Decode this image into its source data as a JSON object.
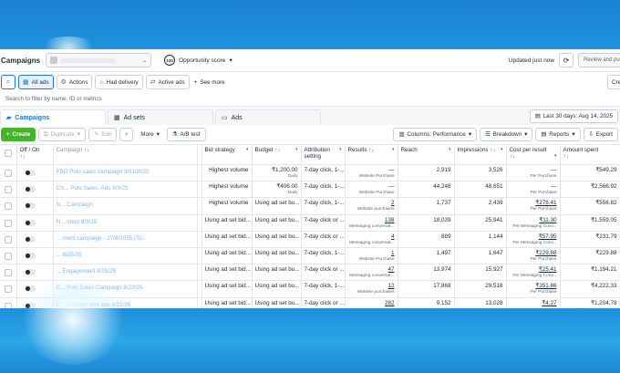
{
  "header": {
    "title": "Campaigns",
    "opportunity_score_badge": "100",
    "opportunity_label": "Opportunity score",
    "updated": "Updated just now",
    "review_label": "Review and pul"
  },
  "filters": {
    "all_ads": "All ads",
    "actions": "Actions",
    "had_delivery": "Had delivery",
    "active_ads": "Active ads",
    "see_more": "See more",
    "create_partial": "Cre",
    "search_placeholder": "Search to filter by name, ID or metrics"
  },
  "tabs": [
    {
      "label": "Campaigns"
    },
    {
      "label": "Ad sets"
    },
    {
      "label": "Ads"
    }
  ],
  "date_range": "Last 30 days: Aug 14, 2025",
  "toolbar": {
    "create": "Create",
    "duplicate": "Duplicate",
    "edit": "Edit",
    "more": "More",
    "ab_test": "A/B test",
    "columns": "Columns: Performance",
    "breakdown": "Breakdown",
    "reports": "Reports",
    "export": "Export"
  },
  "columns": {
    "off_on": "Off / On",
    "campaign": "Campaign",
    "bid_strategy": "Bid strategy",
    "budget": "Budget",
    "attribution_1": "Attribution",
    "attribution_2": "setting",
    "results": "Results",
    "reach": "Reach",
    "impressions": "Impressions",
    "cost_per_result": "Cost per result",
    "amount_spent": "Amount spent",
    "sort_glyph": "↑↓"
  },
  "rows": [
    {
      "campaign": "FSO Polo sales campaign 9/11/2025",
      "bid": "Highest volume",
      "budget": "₹1,200.00",
      "budget_sub": "Daily",
      "attribution": "7-day click, 1-...",
      "results": "—",
      "results_sub": "Website Purchase",
      "results_link": false,
      "reach": "2,919",
      "impressions": "3,526",
      "cost": "—",
      "cost_sub": "Per Purchase",
      "cost_link": false,
      "spent": "₹549.29"
    },
    {
      "campaign": "CS... Polo Sales. Ads 9/5/25",
      "bid": "Highest volume",
      "budget": "₹406.00",
      "budget_sub": "Daily",
      "attribution": "7-day click, 1-...",
      "results": "—",
      "results_sub": "Website Purchase",
      "results_link": false,
      "reach": "44,248",
      "impressions": "48,651",
      "cost": "—",
      "cost_sub": "Per Purchase",
      "cost_link": false,
      "spent": "₹2,566.92"
    },
    {
      "campaign": "N... Campaign",
      "bid": "Highest volume",
      "budget": "Using ad set bu...",
      "budget_sub": "",
      "attribution": "7-day click, 1-...",
      "results": "2",
      "results_sub": "Website purchases",
      "results_link": true,
      "reach": "1,737",
      "impressions": "2,439",
      "cost": "₹278.41",
      "cost_sub": "Per Purchase",
      "cost_link": true,
      "spent": "₹556.82"
    },
    {
      "campaign": "N... ment 8/3/25",
      "bid": "Using ad set bid...",
      "budget": "Using ad set bu...",
      "budget_sub": "",
      "attribution": "7-day click or ...",
      "results": "138",
      "results_sub": "Messaging conversat...",
      "results_link": true,
      "reach": "18,039",
      "impressions": "25,941",
      "cost": "₹11.30",
      "cost_sub": "Per Messaging Conv...",
      "cost_link": true,
      "spent": "₹1,559.05"
    },
    {
      "campaign": "... ment campaign - 27/8/2025 (To...",
      "bid": "Using ad set bid...",
      "budget": "Using ad set bu...",
      "budget_sub": "",
      "attribution": "7-day click or ...",
      "results": "4",
      "results_sub": "Messaging conversat...",
      "results_link": true,
      "reach": "889",
      "impressions": "1,144",
      "cost": "₹57.95",
      "cost_sub": "Per Messaging Conv...",
      "cost_link": true,
      "spent": "₹231.79"
    },
    {
      "campaign": "... 8/25/25",
      "bid": "Using ad set bid...",
      "budget": "Using ad set bu...",
      "budget_sub": "",
      "attribution": "7-day click, 1-...",
      "results": "1",
      "results_sub": "Website Purchase",
      "results_link": true,
      "reach": "1,497",
      "impressions": "1,647",
      "cost": "₹229.88",
      "cost_sub": "Per Purchase",
      "cost_link": true,
      "spent": "₹229.88"
    },
    {
      "campaign": "... Engagement 8/25/25",
      "bid": "Using ad set bid...",
      "budget": "Using ad set bu...",
      "budget_sub": "",
      "attribution": "7-day click or ...",
      "results": "47",
      "results_sub": "Messaging conversat...",
      "results_link": true,
      "reach": "13,974",
      "impressions": "15,927",
      "cost": "₹25.41",
      "cost_sub": "Per Messaging Conv...",
      "cost_link": true,
      "spent": "₹1,194.21"
    },
    {
      "campaign": "C... Polo Sales Campaign 8/22/25",
      "bid": "Using ad set bid...",
      "budget": "Using ad set bu...",
      "budget_sub": "",
      "attribution": "7-day click, 1-...",
      "results": "12",
      "results_sub": "Website purchases",
      "results_link": true,
      "reach": "17,868",
      "impressions": "29,518",
      "cost": "₹351.86",
      "cost_sub": "Per Purchase",
      "cost_link": true,
      "spent": "₹4,222.33"
    },
    {
      "campaign": "C... Engagement ads 8/22/25",
      "bid": "Using ad set bid...",
      "budget": "Using ad set bu...",
      "budget_sub": "",
      "attribution": "7-day click or ...",
      "results": "282",
      "results_sub": "",
      "results_link": true,
      "reach": "9,152",
      "impressions": "13,028",
      "cost": "₹4.27",
      "cost_sub": "",
      "cost_link": true,
      "spent": "₹1,204.78"
    }
  ]
}
